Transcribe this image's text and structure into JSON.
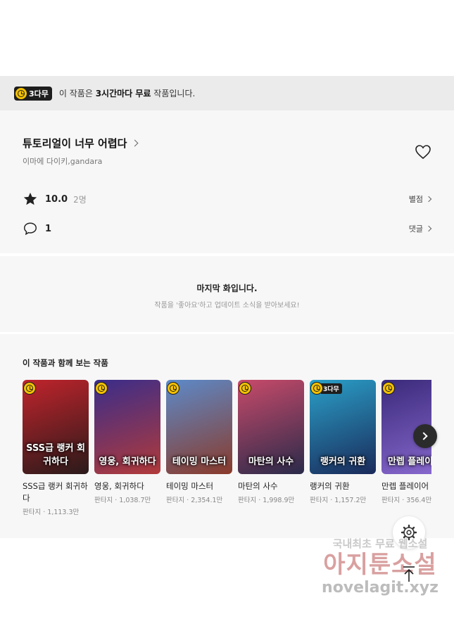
{
  "notice": {
    "badge": "3다무",
    "text_prefix": "이 작품은 ",
    "text_bold": "3시간마다 무료",
    "text_suffix": " 작품입니다."
  },
  "work": {
    "title": "튜토리얼이 너무 어렵다",
    "authors": "이마에 다이키,gandara",
    "rating": "10.0",
    "rating_count": "2명",
    "rating_link": "별점",
    "comment_count": "1",
    "comment_link": "댓글"
  },
  "last_episode": {
    "heading": "마지막 화입니다.",
    "subtext": "작품을 '좋아요'하고 업데이트 소식을 받아보세요!"
  },
  "recommendations": {
    "heading": "이 작품과 함께 보는 작품",
    "items": [
      {
        "name": "SSS급 랭커 회귀하다",
        "meta": "판타지 · 1,113.3만",
        "cover_text": "SSS급 랭커 회귀하다",
        "badge": "",
        "colors": [
          "#c0242c",
          "#2a1a1a"
        ]
      },
      {
        "name": "영웅, 회귀하다",
        "meta": "판타지 · 1,038.7만",
        "cover_text": "영웅, 회귀하다",
        "badge": "",
        "colors": [
          "#3a2d8a",
          "#b23a3a"
        ]
      },
      {
        "name": "테이밍 마스터",
        "meta": "판타지 · 2,354.1만",
        "cover_text": "테이밍 마스터",
        "badge": "",
        "colors": [
          "#5c8ac9",
          "#8a3a2a"
        ]
      },
      {
        "name": "마탄의 사수",
        "meta": "판타지 · 1,998.9만",
        "cover_text": "마탄의 사수",
        "badge": "",
        "colors": [
          "#c84a6a",
          "#2a2a4a"
        ]
      },
      {
        "name": "랭커의 귀환",
        "meta": "판타지 · 1,157.2만",
        "cover_text": "랭커의 귀환",
        "badge": "3다무",
        "colors": [
          "#2aa0c8",
          "#1a2a5a"
        ]
      },
      {
        "name": "만렙 플레이어",
        "meta": "판타지 · 356.4만",
        "cover_text": "만렙 플레이어",
        "badge": "",
        "colors": [
          "#3a2a7a",
          "#8a6ad0"
        ]
      }
    ]
  },
  "watermark": {
    "line1": "국내최초 무료 웹소설",
    "line2": "아지툰소설",
    "line3": "novelagit.xyz"
  }
}
